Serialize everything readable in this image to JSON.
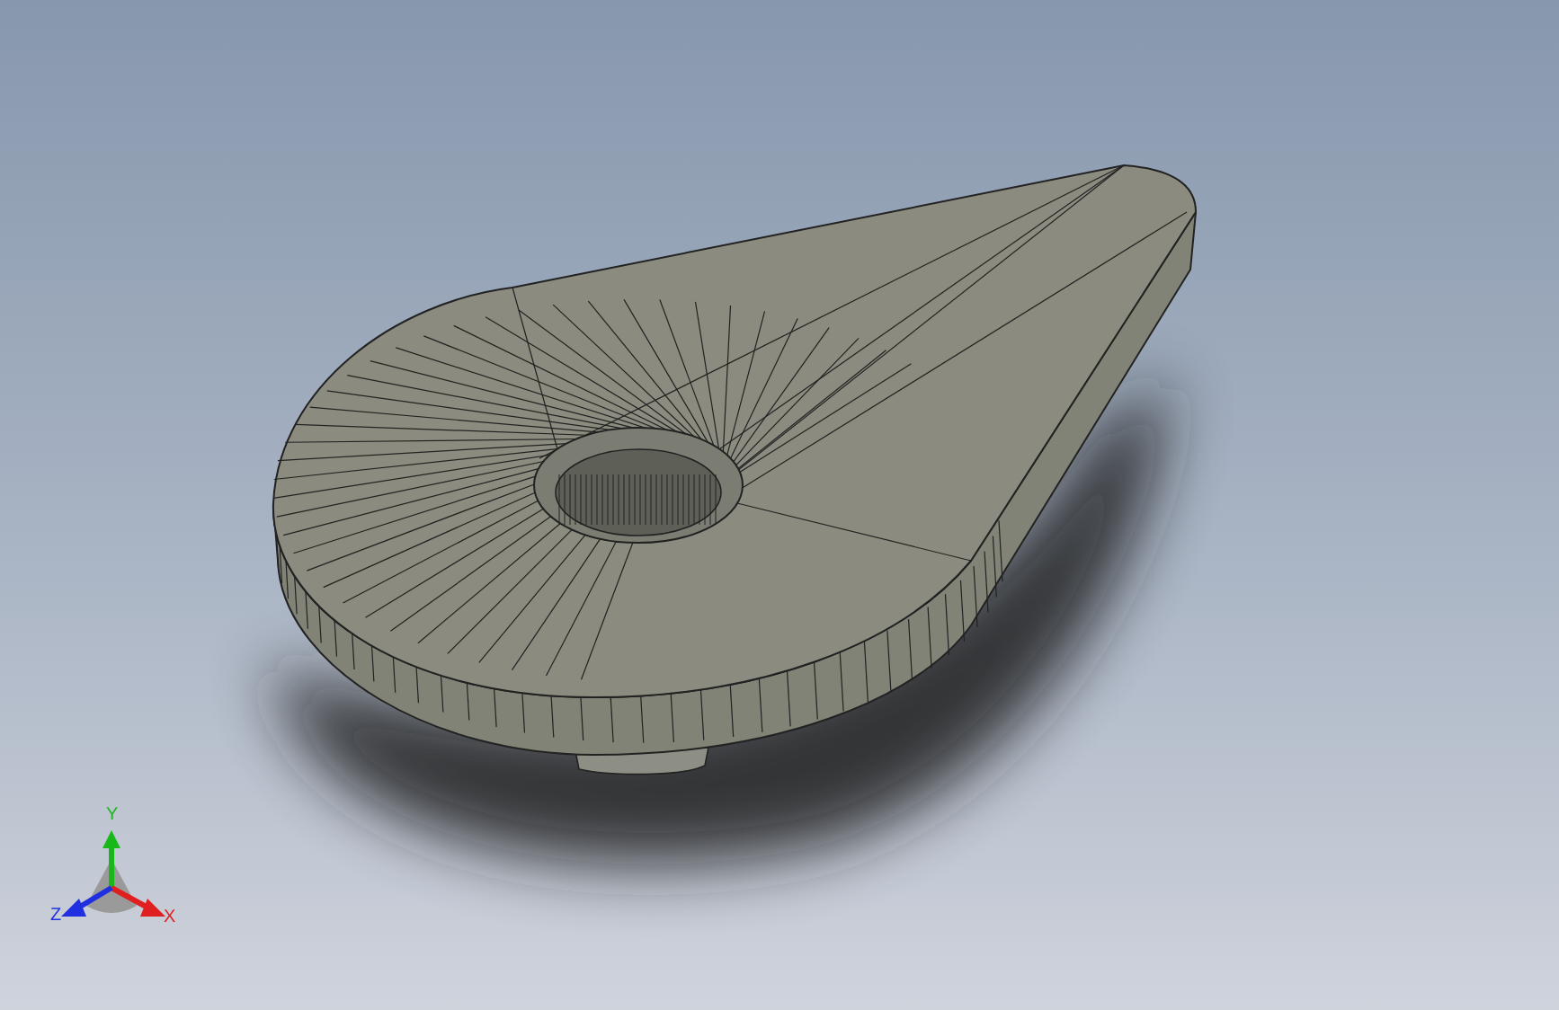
{
  "triad": {
    "y_label": "Y",
    "z_label": "Z",
    "x_label": "X"
  }
}
